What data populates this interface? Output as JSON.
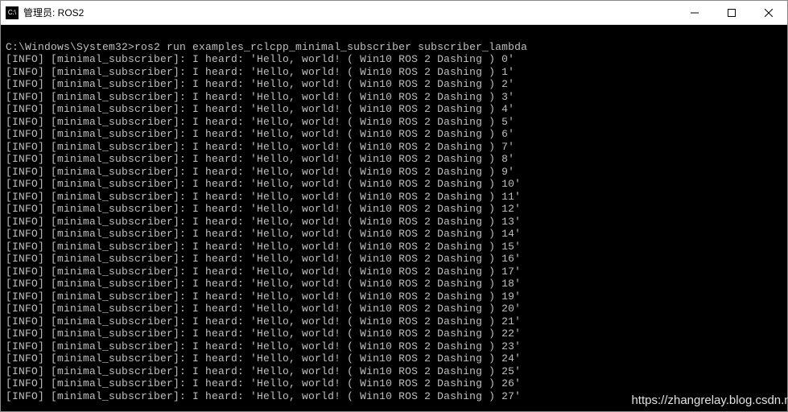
{
  "window": {
    "icon_text": "C:\\",
    "title": "管理员: ROS2"
  },
  "terminal": {
    "prompt": "C:\\Windows\\System32>",
    "command": "ros2 run examples_rclcpp_minimal_subscriber subscriber_lambda",
    "log_level": "[INFO]",
    "node": "[minimal_subscriber]",
    "msg_prefix": "I heard: 'Hello, world! ( Win10 ROS 2 Dashing ) ",
    "msg_suffix": "'",
    "count_start": 0,
    "count_end": 27
  },
  "watermark": "https://zhangrelay.blog.csdn.ne"
}
